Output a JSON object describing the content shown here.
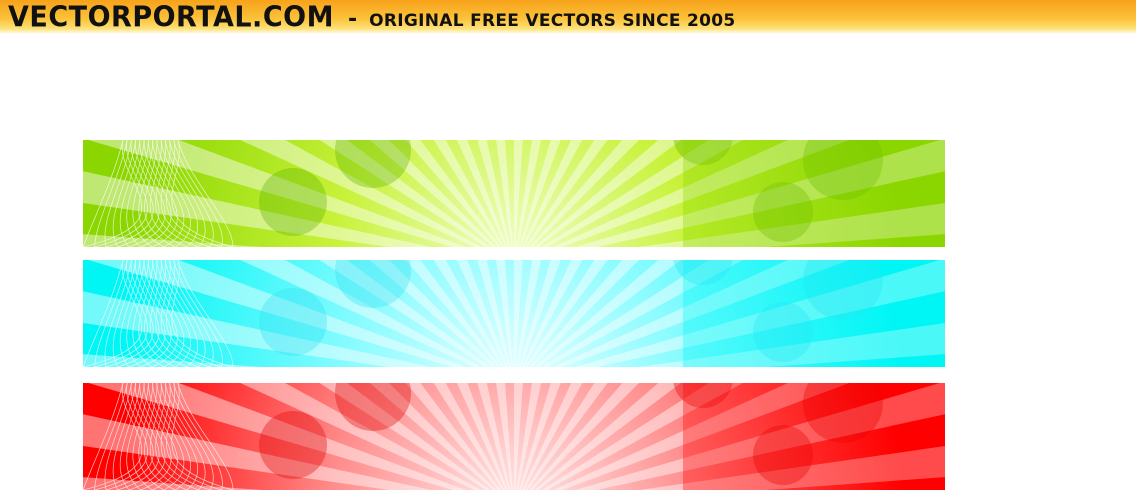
{
  "header": {
    "brand_name": "VECTORPORTAL.COM",
    "separator": "-",
    "tagline": "ORIGINAL FREE VECTORS SINCE 2005"
  },
  "colors": {
    "header_gradient_top": "#f7a21a",
    "header_gradient_bottom": "#fde27a"
  },
  "banners": [
    {
      "name": "green",
      "base": "#8bd600",
      "light": "#f2ffd0",
      "ray": "#c8f23a",
      "shade": "#5fb300"
    },
    {
      "name": "cyan",
      "base": "#00f5f5",
      "light": "#ecffff",
      "ray": "#7ffbff",
      "shade": "#36e0f2"
    },
    {
      "name": "red",
      "base": "#ff0000",
      "light": "#ffecec",
      "ray": "#ff8c8c",
      "shade": "#e00000"
    }
  ]
}
